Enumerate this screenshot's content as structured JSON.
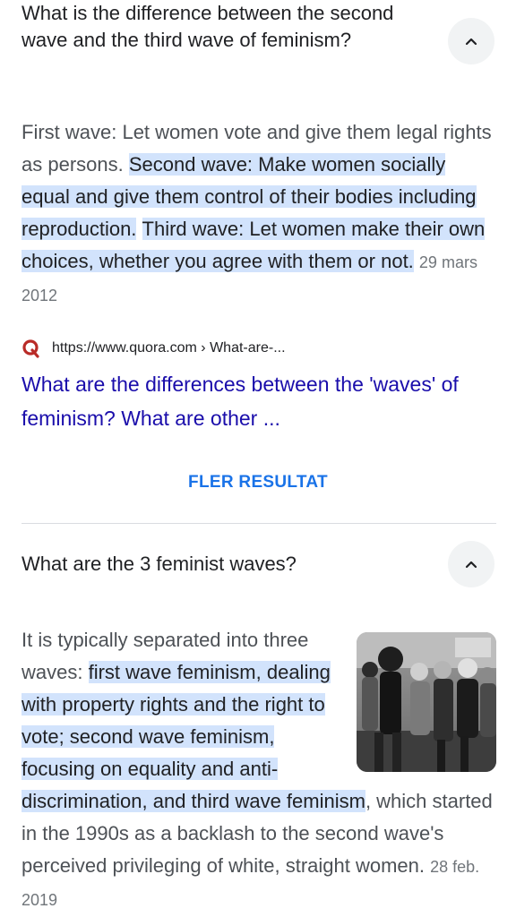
{
  "question1": {
    "title": "What is the difference between the second wave and the third wave of feminism?",
    "answer_plain": "First wave: Let women vote and give them legal rights as persons. ",
    "answer_highlight_1": "Second wave: Make women socially equal and give them control of their bodies including reproduction.",
    "answer_highlight_2": "Third wave: Let women make their own choices, whether you agree with them or not.",
    "date": "29 mars 2012",
    "source_url": "https://www.quora.com › What-are-...",
    "source_icon": "quora-icon",
    "result_title": "What are the differences between the 'waves' of feminism? What are other ..."
  },
  "more_results": "FLER RESULTAT",
  "question2": {
    "title": "What are the 3 feminist waves?",
    "answer_plain_1": "It is typically separated into three waves: ",
    "answer_highlight": "first wave feminism, dealing with property rights and the right to vote; second wave feminism, focusing on equality and anti-discrimination, and third wave feminism",
    "answer_plain_2": ", which started in the 1990s as a backlash to the second wave's perceived privileging of white, straight women.",
    "date": "28 feb. 2019",
    "image": "protest-march-photo"
  },
  "colors": {
    "highlight": "#d2e3fc",
    "link": "#1a0dab",
    "button_text": "#1a73e8",
    "quora_red": "#b92b27"
  }
}
